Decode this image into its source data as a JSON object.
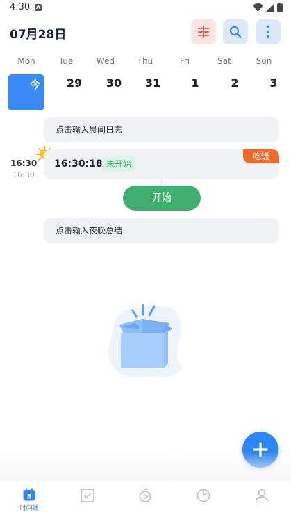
{
  "status": {
    "time": "4:30",
    "notification_glyph": "A"
  },
  "header": {
    "date": "07月28日"
  },
  "week": {
    "days": [
      {
        "weekday": "Mon",
        "num": "今",
        "today": true
      },
      {
        "weekday": "Tue",
        "num": "29"
      },
      {
        "weekday": "Wed",
        "num": "30"
      },
      {
        "weekday": "Thu",
        "num": "31"
      },
      {
        "weekday": "Fri",
        "num": "1"
      },
      {
        "weekday": "Sat",
        "num": "2"
      },
      {
        "weekday": "Sun",
        "num": "3"
      }
    ]
  },
  "timeline": {
    "morning_prompt": "点击输入晨间日志",
    "evening_prompt": "点击输入夜晚总结",
    "time_main": "16:30",
    "time_sub": "16:30",
    "task": {
      "countdown": "16:30:18",
      "status": "未开始",
      "tag": "吃饭"
    },
    "start_label": "开始"
  },
  "nav": {
    "items": [
      {
        "name": "timeline",
        "label": "时间线",
        "badge": "8",
        "active": true
      },
      {
        "name": "todo",
        "label": ""
      },
      {
        "name": "timer",
        "label": ""
      },
      {
        "name": "stats",
        "label": ""
      },
      {
        "name": "profile",
        "label": ""
      }
    ]
  },
  "colors": {
    "accent": "#2f86f0",
    "today": "#3b8bf6",
    "start": "#3fae6f",
    "tag": "#f26b2a",
    "status_text": "#3ab36d"
  }
}
